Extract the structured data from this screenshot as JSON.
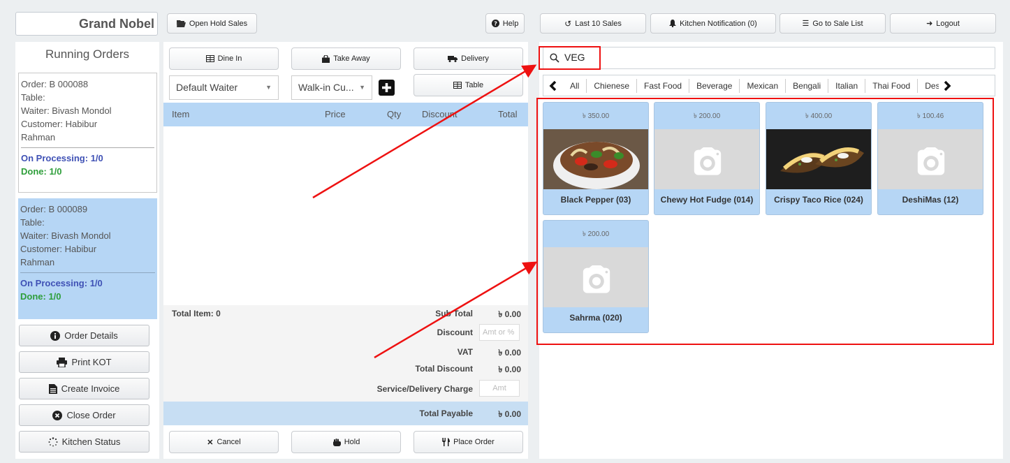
{
  "brand": {
    "name": "Grand Nobel"
  },
  "top_buttons": {
    "open_hold": "Open Hold Sales",
    "help": "Help",
    "last10": "Last 10 Sales",
    "kitchen_notification": "Kitchen Notification (0)",
    "go_sale_list": "Go to Sale List",
    "logout": "Logout"
  },
  "running": {
    "title": "Running Orders",
    "orders": [
      {
        "order": "Order: B 000088",
        "table": "Table:",
        "waiter": "Waiter: Bivash Mondol",
        "customer": "Customer: Habibur",
        "customer2": "Rahman",
        "processing": "On Processing: 1/0",
        "done": "Done: 1/0"
      },
      {
        "order": "Order: B 000089",
        "table": "Table:",
        "waiter": "Waiter: Bivash Mondol",
        "customer": "Customer: Habibur",
        "customer2": "Rahman",
        "processing": "On Processing: 1/0",
        "done": "Done: 1/0"
      }
    ],
    "actions": [
      "Order Details",
      "Print KOT",
      "Create Invoice",
      "Close Order",
      "Kitchen Status"
    ]
  },
  "order_type": {
    "dine_in": "Dine In",
    "take_away": "Take Away",
    "delivery": "Delivery",
    "table": "Table"
  },
  "selects": {
    "waiter": "Default Waiter",
    "customer": "Walk-in Cu..."
  },
  "cart": {
    "headers": {
      "item": "Item",
      "price": "Price",
      "qty": "Qty",
      "discount": "Discount",
      "total": "Total"
    },
    "total_item": "Total Item: 0",
    "sub_total_label": "Sub Total",
    "sub_total": "৳ 0.00",
    "discount_label": "Discount",
    "discount_placeholder": "Amt or %",
    "vat_label": "VAT",
    "vat": "৳ 0.00",
    "total_discount_label": "Total Discount",
    "total_discount": "৳ 0.00",
    "service_label": "Service/Delivery Charge",
    "service_placeholder": "Amt",
    "payable_label": "Total Payable",
    "payable": "৳ 0.00"
  },
  "bottom_buttons": {
    "cancel": "Cancel",
    "hold": "Hold",
    "place_order": "Place Order"
  },
  "search": {
    "value": "VEG"
  },
  "categories": [
    "All",
    "Chienese",
    "Fast Food",
    "Beverage",
    "Mexican",
    "Bengali",
    "Italian",
    "Thai Food",
    "Des"
  ],
  "items": [
    {
      "price": "৳ 350.00",
      "name": "Black Pepper (03)",
      "image": "food-photo"
    },
    {
      "price": "৳ 200.00",
      "name": "Chewy Hot Fudge (014)",
      "image": "camera-placeholder"
    },
    {
      "price": "৳ 400.00",
      "name": "Crispy Taco Rice (024)",
      "image": "food-photo"
    },
    {
      "price": "৳ 100.46",
      "name": "DeshiMas (12)",
      "image": "camera-placeholder"
    },
    {
      "price": "৳ 200.00",
      "name": "Sahrma (020)",
      "image": "camera-placeholder"
    }
  ],
  "colors": {
    "accent": "#b6d6f5",
    "annotation": "#e11111",
    "processing": "#3f51b5",
    "done": "#2e9e3a"
  }
}
